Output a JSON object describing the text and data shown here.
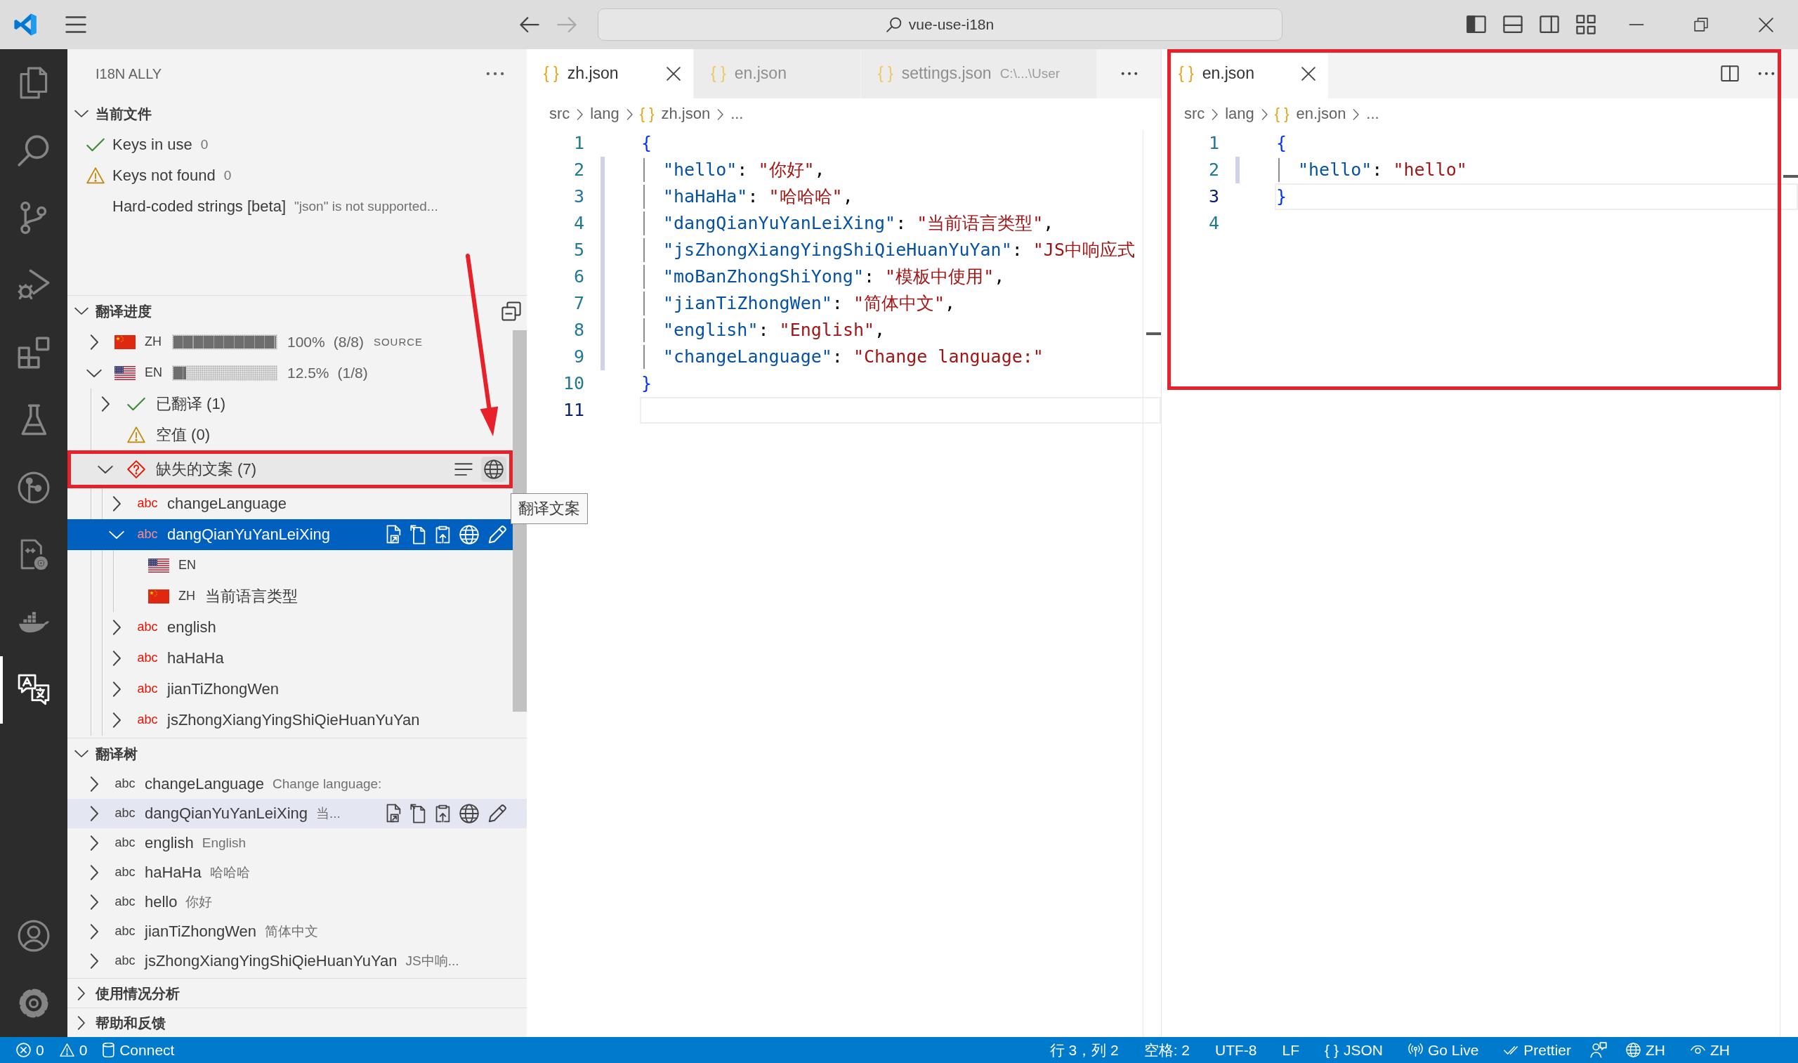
{
  "title_bar": {
    "nav": [
      {
        "kind": "back",
        "disabled": false
      },
      {
        "kind": "forward",
        "disabled": true
      }
    ],
    "search": "vue-use-i18n"
  },
  "activity_bar": {
    "items": [
      {
        "kind": "files",
        "selected": false
      },
      {
        "kind": "search",
        "selected": false
      },
      {
        "kind": "branch",
        "selected": false
      },
      {
        "kind": "debug",
        "selected": false
      },
      {
        "kind": "extensions",
        "selected": false
      },
      {
        "kind": "flask",
        "selected": false
      },
      {
        "kind": "graph",
        "selected": false
      },
      {
        "kind": "config",
        "selected": false
      },
      {
        "kind": "whale",
        "selected": false
      },
      {
        "kind": "translate",
        "selected": true
      }
    ],
    "bottom": [
      {
        "kind": "account"
      },
      {
        "kind": "gear"
      }
    ]
  },
  "sidebar": {
    "title": "I18N ALLY",
    "sections": [
      {
        "kind": "current",
        "title": "当前文件",
        "expanded": true,
        "items": [
          {
            "kind": "ok",
            "label": "Keys in use",
            "detail": "0"
          },
          {
            "kind": "warning",
            "label": "Keys not found",
            "detail": "0"
          },
          {
            "kind": "plain",
            "label": "Hard-coded strings [beta]",
            "detail": "\"json\" is not supported..."
          }
        ]
      },
      {
        "kind": "progress",
        "title": "翻译进度",
        "expanded": true,
        "locales": [
          {
            "kind": "china",
            "code": "ZH",
            "level": 1,
            "percent": "100%",
            "fraction": "(8/8)",
            "tag": "SOURCE",
            "expanded": false
          },
          {
            "kind": "usa",
            "code": "EN",
            "level": 0.125,
            "percent": "12.5%",
            "fraction": "(1/8)",
            "expanded": true,
            "groups": [
              {
                "kind": "ok",
                "label": "已翻译 (1)",
                "expanded": false,
                "hovered": false
              },
              {
                "kind": "warning",
                "label": "空值 (0)",
                "hovered": false
              },
              {
                "kind": "missing",
                "label": "缺失的文案 (7)",
                "expanded": true,
                "hovered": true,
                "tooltip": "翻译文案",
                "keys": [
                  {
                    "glyph": "abc",
                    "key": "changeLanguage",
                    "expanded": false,
                    "selected": false
                  },
                  {
                    "glyph": "abc",
                    "key": "dangQianYuYanLeiXing",
                    "expanded": true,
                    "selected": true,
                    "values": [
                      {
                        "kind": "usa",
                        "code": "EN"
                      },
                      {
                        "kind": "china",
                        "code": "ZH",
                        "text": "当前语言类型"
                      }
                    ]
                  },
                  {
                    "glyph": "abc",
                    "key": "english",
                    "expanded": false,
                    "selected": false
                  },
                  {
                    "glyph": "abc",
                    "key": "haHaHa",
                    "expanded": false,
                    "selected": false
                  },
                  {
                    "glyph": "abc",
                    "key": "jianTiZhongWen",
                    "expanded": false,
                    "selected": false
                  },
                  {
                    "glyph": "abc",
                    "key": "jsZhongXiangYingShiQieHuanYuYan",
                    "expanded": false,
                    "selected": false
                  }
                ]
              }
            ]
          }
        ]
      },
      {
        "kind": "tree",
        "title": "翻译树",
        "expanded": true,
        "keys": [
          {
            "glyph": "abc",
            "key": "changeLanguage",
            "value": "Change language:",
            "expanded": false,
            "hovered": false
          },
          {
            "glyph": "abc",
            "key": "dangQianYuYanLeiXing",
            "value": "当...",
            "expanded": false,
            "hovered": true
          },
          {
            "glyph": "abc",
            "key": "english",
            "value": "English",
            "expanded": false,
            "hovered": false
          },
          {
            "glyph": "abc",
            "key": "haHaHa",
            "value": "哈哈哈",
            "expanded": false,
            "hovered": false
          },
          {
            "glyph": "abc",
            "key": "hello",
            "value": "你好",
            "expanded": false,
            "hovered": false
          },
          {
            "glyph": "abc",
            "key": "jianTiZhongWen",
            "value": "简体中文",
            "expanded": false,
            "hovered": false
          },
          {
            "glyph": "abc",
            "key": "jsZhongXiangYingShiQieHuanYuYan",
            "value": "JS中响...",
            "expanded": false,
            "hovered": false
          }
        ]
      },
      {
        "title": "使用情况分析",
        "expanded": false
      },
      {
        "title": "帮助和反馈",
        "expanded": false
      }
    ]
  },
  "editor_groups": [
    {
      "tabs": [
        {
          "glyph": "{ }",
          "label": "zh.json",
          "selected": true
        },
        {
          "glyph": "{ }",
          "label": "en.json",
          "selected": false
        },
        {
          "glyph": "{ }",
          "label": "settings.json",
          "description": "C:\\...\\User",
          "selected": false
        }
      ],
      "actions": [
        {
          "kind": "more"
        }
      ],
      "breadcrumbs": [
        {
          "text": "src"
        },
        {
          "text": "lang"
        },
        {
          "glyph": "{ }",
          "text": "zh.json"
        },
        {
          "text": "..."
        }
      ],
      "lines": [
        {
          "number": "1",
          "current": false,
          "indented": false,
          "tokens": [
            {
              "kind": "brace",
              "text": "{"
            }
          ]
        },
        {
          "number": "2",
          "current": false,
          "indented": true,
          "tokens": [
            {
              "kind": "key",
              "text": "\"hello\""
            },
            {
              "kind": "punct",
              "text": ": "
            },
            {
              "kind": "string",
              "text": "\"你好\""
            },
            {
              "kind": "punct",
              "text": ","
            }
          ]
        },
        {
          "number": "3",
          "current": false,
          "indented": true,
          "tokens": [
            {
              "kind": "key",
              "text": "\"haHaHa\""
            },
            {
              "kind": "punct",
              "text": ": "
            },
            {
              "kind": "string",
              "text": "\"哈哈哈\""
            },
            {
              "kind": "punct",
              "text": ","
            }
          ]
        },
        {
          "number": "4",
          "current": false,
          "indented": true,
          "tokens": [
            {
              "kind": "key",
              "text": "\"dangQianYuYanLeiXing\""
            },
            {
              "kind": "punct",
              "text": ": "
            },
            {
              "kind": "string",
              "text": "\"当前语言类型\""
            },
            {
              "kind": "punct",
              "text": ","
            }
          ]
        },
        {
          "number": "5",
          "current": false,
          "indented": true,
          "tokens": [
            {
              "kind": "key",
              "text": "\"jsZhongXiangYingShiQieHuanYuYan\""
            },
            {
              "kind": "punct",
              "text": ": "
            },
            {
              "kind": "string",
              "text": "\"JS中响应式"
            }
          ]
        },
        {
          "number": "6",
          "current": false,
          "indented": true,
          "tokens": [
            {
              "kind": "key",
              "text": "\"moBanZhongShiYong\""
            },
            {
              "kind": "punct",
              "text": ": "
            },
            {
              "kind": "string",
              "text": "\"模板中使用\""
            },
            {
              "kind": "punct",
              "text": ","
            }
          ]
        },
        {
          "number": "7",
          "current": false,
          "indented": true,
          "tokens": [
            {
              "kind": "key",
              "text": "\"jianTiZhongWen\""
            },
            {
              "kind": "punct",
              "text": ": "
            },
            {
              "kind": "string",
              "text": "\"简体中文\""
            },
            {
              "kind": "punct",
              "text": ","
            }
          ]
        },
        {
          "number": "8",
          "current": false,
          "indented": true,
          "tokens": [
            {
              "kind": "key",
              "text": "\"english\""
            },
            {
              "kind": "punct",
              "text": ": "
            },
            {
              "kind": "string",
              "text": "\"English\""
            },
            {
              "kind": "punct",
              "text": ","
            }
          ]
        },
        {
          "number": "9",
          "current": false,
          "indented": true,
          "tokens": [
            {
              "kind": "key",
              "text": "\"changeLanguage\""
            },
            {
              "kind": "punct",
              "text": ": "
            },
            {
              "kind": "string",
              "text": "\"Change language:\""
            }
          ]
        },
        {
          "number": "10",
          "current": false,
          "indented": false,
          "tokens": [
            {
              "kind": "brace",
              "text": "}"
            }
          ]
        },
        {
          "number": "11",
          "current": true,
          "indented": false
        }
      ]
    },
    {
      "tabs": [
        {
          "glyph": "{ }",
          "label": "en.json",
          "selected": true
        }
      ],
      "actions": [
        {
          "kind": "split"
        },
        {
          "kind": "more"
        }
      ],
      "breadcrumbs": [
        {
          "text": "src"
        },
        {
          "text": "lang"
        },
        {
          "glyph": "{ }",
          "text": "en.json"
        },
        {
          "text": "..."
        }
      ],
      "lines": [
        {
          "number": "1",
          "current": false,
          "indented": false,
          "tokens": [
            {
              "kind": "brace",
              "text": "{"
            }
          ]
        },
        {
          "number": "2",
          "current": false,
          "indented": true,
          "tokens": [
            {
              "kind": "key",
              "text": "\"hello\""
            },
            {
              "kind": "punct",
              "text": ": "
            },
            {
              "kind": "string",
              "text": "\"hello\""
            }
          ]
        },
        {
          "number": "3",
          "current": true,
          "indented": false,
          "tokens": [
            {
              "kind": "brace",
              "text": "}"
            }
          ]
        },
        {
          "number": "4",
          "current": false,
          "indented": false
        }
      ]
    }
  ],
  "status_bar": {
    "left": [
      {
        "kind": "errors",
        "text": "0"
      },
      {
        "kind": "warnings",
        "text": "0"
      },
      {
        "kind": "remote",
        "text": "Connect"
      }
    ],
    "right": [
      {
        "kind": "plain",
        "text": "行 3，列 2"
      },
      {
        "kind": "plain",
        "text": "空格: 2"
      },
      {
        "kind": "plain",
        "text": "UTF-8"
      },
      {
        "kind": "plain",
        "text": "LF"
      },
      {
        "kind": "language",
        "glyph": "{ }",
        "text": "JSON"
      },
      {
        "kind": "live",
        "text": "Go Live"
      },
      {
        "kind": "prettier",
        "text": "Prettier"
      },
      {
        "kind": "feedback"
      },
      {
        "kind": "globe",
        "text": "ZH"
      },
      {
        "kind": "eye",
        "text": "ZH"
      }
    ]
  }
}
